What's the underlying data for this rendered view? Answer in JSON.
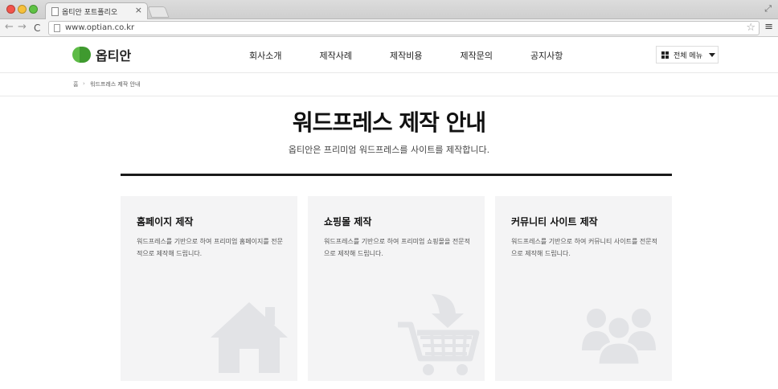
{
  "browser": {
    "tab_title": "옵티안 포트폴리오",
    "tab_close": "×",
    "url": "www.optian.co.kr",
    "back": "←",
    "forward": "→",
    "reload": "C",
    "star": "☆",
    "menu": "≡",
    "fullscreen": "⤢"
  },
  "header": {
    "logo_text": "옵티안",
    "nav": [
      "회사소개",
      "제작사례",
      "제작비용",
      "제작문의",
      "공지사항"
    ],
    "all_menu_label": "전체 메뉴"
  },
  "breadcrumb": {
    "home": "홈",
    "separator": "›",
    "current": "워드프레스 제작 안내"
  },
  "hero": {
    "title": "워드프레스 제작 안내",
    "subtitle": "옵티안은 프리미엄 워드프레스를 사이트를 제작합니다."
  },
  "cards": [
    {
      "title": "홈페이지 제작",
      "desc": "워드프레스를 기반으로 하여 프리미엄 홈페이지를 전문적으로 제작해 드립니다.",
      "icon": "house-icon"
    },
    {
      "title": "쇼핑몰 제작",
      "desc": "워드프레스를 기반으로 하여 프리미엄 쇼핑몰을 전문적으로 제작해 드립니다.",
      "icon": "shopping-cart-icon"
    },
    {
      "title": "커뮤니티 사이트 제작",
      "desc": "워드프레스를 기반으로 하여 커뮤니티 사이트를 전문적으로 제작해 드립니다.",
      "icon": "community-icon"
    }
  ],
  "colors": {
    "brand_green": "#5dbb46",
    "brand_green_dark": "#3f9a2f",
    "card_bg": "#f4f4f5",
    "icon_gray": "#e2e3e6"
  }
}
